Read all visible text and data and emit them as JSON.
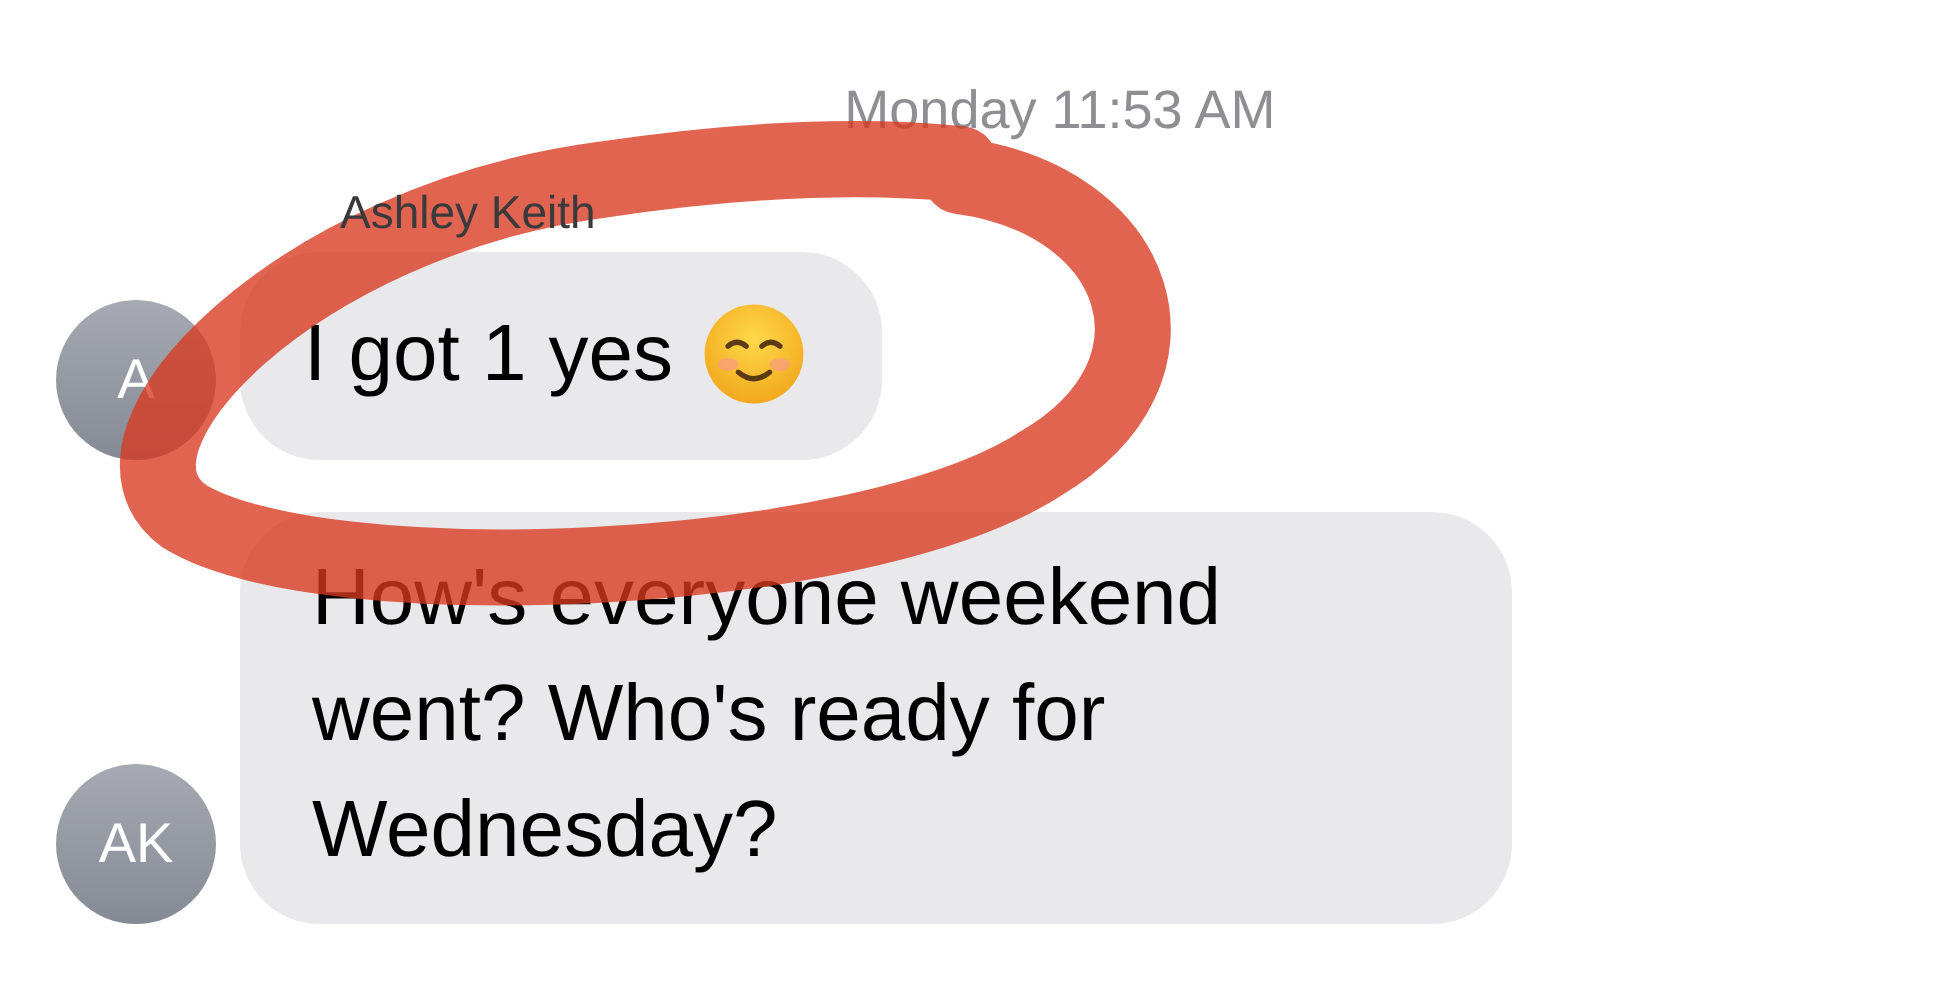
{
  "timestamp": "Monday 11:53 AM",
  "messages": [
    {
      "sender": "Ashley  Keith",
      "avatar": "A",
      "text": "I got 1 yes",
      "emoji": true
    },
    {
      "avatar": "AK",
      "text": "How's everyone weekend went? Who's ready for Wednesday?",
      "emoji": false
    }
  ]
}
